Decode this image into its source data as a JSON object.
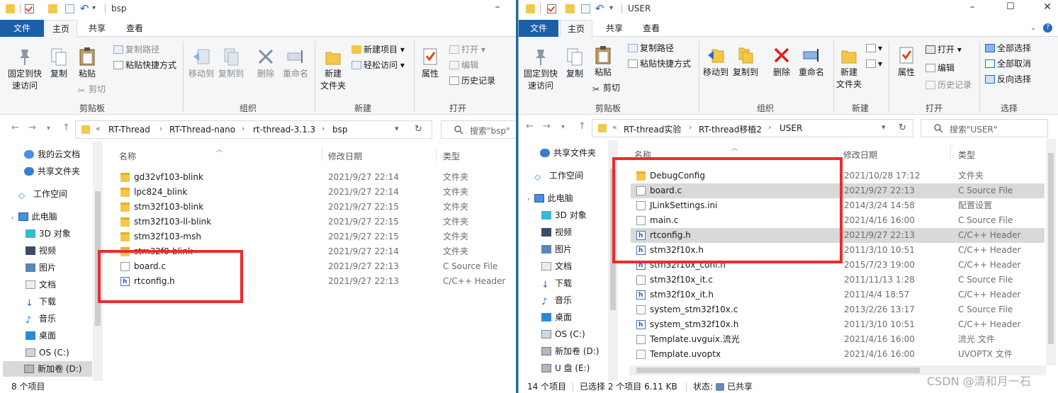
{
  "left": {
    "title": "bsp",
    "tabs": {
      "file": "文件",
      "home": "主页",
      "share": "共享",
      "view": "查看"
    },
    "ribbon": {
      "pin": "固定到快\n速访问",
      "copy": "复制",
      "paste": "粘贴",
      "copy_path": "复制路径",
      "paste_shortcut": "粘贴快捷方式",
      "cut": "剪切",
      "clipboard": "剪贴板",
      "move_to": "移动到",
      "copy_to": "复制到",
      "delete": "删除",
      "rename": "重命名",
      "organize": "组织",
      "new_folder": "新建\n文件夹",
      "new_item": "新建项目",
      "easy_access": "轻松访问",
      "new": "新建",
      "properties": "属性",
      "open": "打开",
      "edit": "编辑",
      "history": "历史记录",
      "open_group": "打开"
    },
    "address": {
      "crumbs": [
        "RT-Thread",
        "RT-Thread-nano",
        "rt-thread-3.1.3",
        "bsp"
      ],
      "search_placeholder": "搜索\"bsp\""
    },
    "nav": [
      "我的云文档",
      "共享文件夹",
      "工作空间",
      "此电脑",
      "3D 对象",
      "视频",
      "图片",
      "文档",
      "下载",
      "音乐",
      "桌面",
      "OS (C:)",
      "新加卷 (D:)"
    ],
    "columns": {
      "name": "名称",
      "date": "修改日期",
      "type": "类型"
    },
    "files": [
      {
        "name": "gd32vf103-blink",
        "date": "2021/9/27 22:14",
        "type": "文件夹",
        "kind": "folder"
      },
      {
        "name": "lpc824_blink",
        "date": "2021/9/27 22:14",
        "type": "文件夹",
        "kind": "folder"
      },
      {
        "name": "stm32f103-blink",
        "date": "2021/9/27 22:15",
        "type": "文件夹",
        "kind": "folder"
      },
      {
        "name": "stm32f103-ll-blink",
        "date": "2021/9/27 22:15",
        "type": "文件夹",
        "kind": "folder"
      },
      {
        "name": "stm32f103-msh",
        "date": "2021/9/27 22:15",
        "type": "文件夹",
        "kind": "folder"
      },
      {
        "name": "stm32f0-blink",
        "date": "2021/9/27 22:14",
        "type": "文件夹",
        "kind": "folder"
      },
      {
        "name": "board.c",
        "date": "2021/9/27 22:13",
        "type": "C Source File",
        "kind": "c"
      },
      {
        "name": "rtconfig.h",
        "date": "2021/9/27 22:13",
        "type": "C/C++ Header",
        "kind": "h"
      }
    ],
    "status": "8 个项目"
  },
  "right": {
    "title": "USER",
    "tabs": {
      "file": "文件",
      "home": "主页",
      "share": "共享",
      "view": "查看"
    },
    "ribbon": {
      "pin": "固定到快\n速访问",
      "copy": "复制",
      "paste": "粘贴",
      "copy_path": "复制路径",
      "paste_shortcut": "粘贴快捷方式",
      "cut": "剪切",
      "clipboard": "剪贴板",
      "move_to": "移动到",
      "copy_to": "复制到",
      "delete": "删除",
      "rename": "重命名",
      "organize": "组织",
      "new_folder": "新建\n文件夹",
      "new_item": "",
      "easy_access": "",
      "new": "新建",
      "properties": "属性",
      "open": "打开",
      "edit": "编辑",
      "history": "历史记录",
      "open_group": "打开",
      "select_all": "全部选择",
      "select_none": "全部取消",
      "invert": "反向选择",
      "select": "选择"
    },
    "address": {
      "crumbs": [
        "RT-thread实验",
        "RT-thread移植2",
        "USER"
      ],
      "search_placeholder": "搜索\"USER\""
    },
    "nav": [
      "共享文件夹",
      "工作空间",
      "此电脑",
      "3D 对象",
      "视频",
      "图片",
      "文档",
      "下载",
      "音乐",
      "桌面",
      "OS (C:)",
      "新加卷 (D:)",
      "U 盘 (E:)"
    ],
    "columns": {
      "name": "名称",
      "date": "修改日期",
      "type": "类型"
    },
    "files": [
      {
        "name": "DebugConfig",
        "date": "2021/10/28 17:12",
        "type": "文件夹",
        "kind": "folder",
        "selected": false
      },
      {
        "name": "board.c",
        "date": "2021/9/27 22:13",
        "type": "C Source File",
        "kind": "c",
        "selected": true
      },
      {
        "name": "JLinkSettings.ini",
        "date": "2014/3/24 14:58",
        "type": "配置设置",
        "kind": "ini",
        "selected": false
      },
      {
        "name": "main.c",
        "date": "2021/4/16 16:00",
        "type": "C Source File",
        "kind": "c",
        "selected": false
      },
      {
        "name": "rtconfig.h",
        "date": "2021/9/27 22:13",
        "type": "C/C++ Header",
        "kind": "h",
        "selected": true
      },
      {
        "name": "stm32f10x.h",
        "date": "2011/3/10 10:51",
        "type": "C/C++ Header",
        "kind": "h",
        "selected": false
      },
      {
        "name": "stm32f10x_conf.h",
        "date": "2015/7/23 19:00",
        "type": "C/C++ Header",
        "kind": "h",
        "selected": false
      },
      {
        "name": "stm32f10x_it.c",
        "date": "2011/11/13 1:28",
        "type": "C Source File",
        "kind": "c",
        "selected": false
      },
      {
        "name": "stm32f10x_it.h",
        "date": "2011/4/4 18:57",
        "type": "C/C++ Header",
        "kind": "h",
        "selected": false
      },
      {
        "name": "system_stm32f10x.c",
        "date": "2013/2/26 13:17",
        "type": "C Source File",
        "kind": "c",
        "selected": false
      },
      {
        "name": "system_stm32f10x.h",
        "date": "2011/3/10 10:51",
        "type": "C/C++ Header",
        "kind": "h",
        "selected": false
      },
      {
        "name": "Template.uvguix.流光",
        "date": "2021/4/16 16:00",
        "type": "流光 文件",
        "kind": "ini",
        "selected": false
      },
      {
        "name": "Template.uvoptx",
        "date": "2021/4/16 16:00",
        "type": "UVOPTX 文件",
        "kind": "ini",
        "selected": false
      }
    ],
    "status": {
      "count": "14 个项目",
      "selected": "已选择 2 个项目  6.11 KB",
      "state": "状态:",
      "shared": "已共享"
    }
  },
  "watermark": "CSDN @清和月一石"
}
